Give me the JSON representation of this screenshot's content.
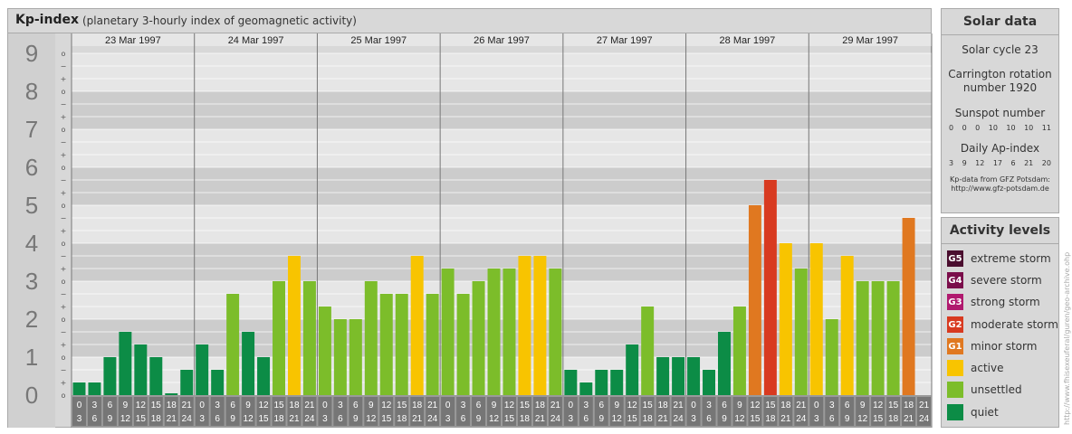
{
  "header": {
    "title": "Kp-index",
    "subtitle": "(planetary 3-hourly index of geomagnetic activity)"
  },
  "chart_data": {
    "type": "bar",
    "ylim": [
      0,
      9
    ],
    "y_major_ticks": [
      "0",
      "1",
      "2",
      "3",
      "4",
      "5",
      "6",
      "7",
      "8",
      "9"
    ],
    "y_minor_ticks": [
      "o",
      "+",
      "−",
      "o"
    ],
    "days": [
      "23 Mar 1997",
      "24 Mar 1997",
      "25 Mar 1997",
      "26 Mar 1997",
      "27 Mar 1997",
      "28 Mar 1997",
      "29 Mar 1997"
    ],
    "interval_labels": [
      [
        "0",
        "3"
      ],
      [
        "3",
        "6"
      ],
      [
        "6",
        "9"
      ],
      [
        "9",
        "12"
      ],
      [
        "12",
        "15"
      ],
      [
        "15",
        "18"
      ],
      [
        "18",
        "21"
      ],
      [
        "21",
        "24"
      ]
    ],
    "values": [
      0.333,
      0.333,
      1.0,
      1.667,
      1.333,
      1.0,
      0,
      0.667,
      1.333,
      0.667,
      2.667,
      1.667,
      1.0,
      3.0,
      3.667,
      3.0,
      2.333,
      2.0,
      2.0,
      3.0,
      2.667,
      2.667,
      3.667,
      2.667,
      3.333,
      2.667,
      3.0,
      3.333,
      3.333,
      3.667,
      3.667,
      3.333,
      0.667,
      0.333,
      0.667,
      0.667,
      1.333,
      2.333,
      1.0,
      1.0,
      1.0,
      0.667,
      1.667,
      2.333,
      5.0,
      5.667,
      4.0,
      3.333,
      4.0,
      2.0,
      3.667,
      3.0,
      3.0,
      3.0,
      4.667
    ],
    "grid": true
  },
  "solar": {
    "title": "Solar data",
    "cycle": "Solar cycle 23",
    "carrington_1": "Carrington rotation",
    "carrington_2": "number 1920",
    "sunspot_label": "Sunspot number",
    "sunspot_values": [
      "0",
      "0",
      "0",
      "10",
      "10",
      "10",
      "11"
    ],
    "ap_label": "Daily Ap-index",
    "ap_values": [
      "3",
      "9",
      "12",
      "17",
      "6",
      "21",
      "20"
    ],
    "source_1": "Kp-data from GFZ Potsdam:",
    "source_2": "http://www.gfz-potsdam.de"
  },
  "activity": {
    "title": "Activity levels",
    "levels": [
      {
        "code": "G5",
        "label": "extreme storm",
        "color": "#4a0d2e"
      },
      {
        "code": "G4",
        "label": "severe storm",
        "color": "#7a0d4a"
      },
      {
        "code": "G3",
        "label": "strong storm",
        "color": "#b0196e"
      },
      {
        "code": "G2",
        "label": "moderate storm",
        "color": "#d83a20"
      },
      {
        "code": "G1",
        "label": "minor storm",
        "color": "#e07820"
      },
      {
        "code": "",
        "label": "active",
        "color": "#f8c400"
      },
      {
        "code": "",
        "label": "unsettled",
        "color": "#7cbd2a"
      },
      {
        "code": "",
        "label": "quiet",
        "color": "#0c8c46"
      }
    ]
  },
  "credit": "http://www.fhisexeuferal/guren/geo-archive.ohp"
}
